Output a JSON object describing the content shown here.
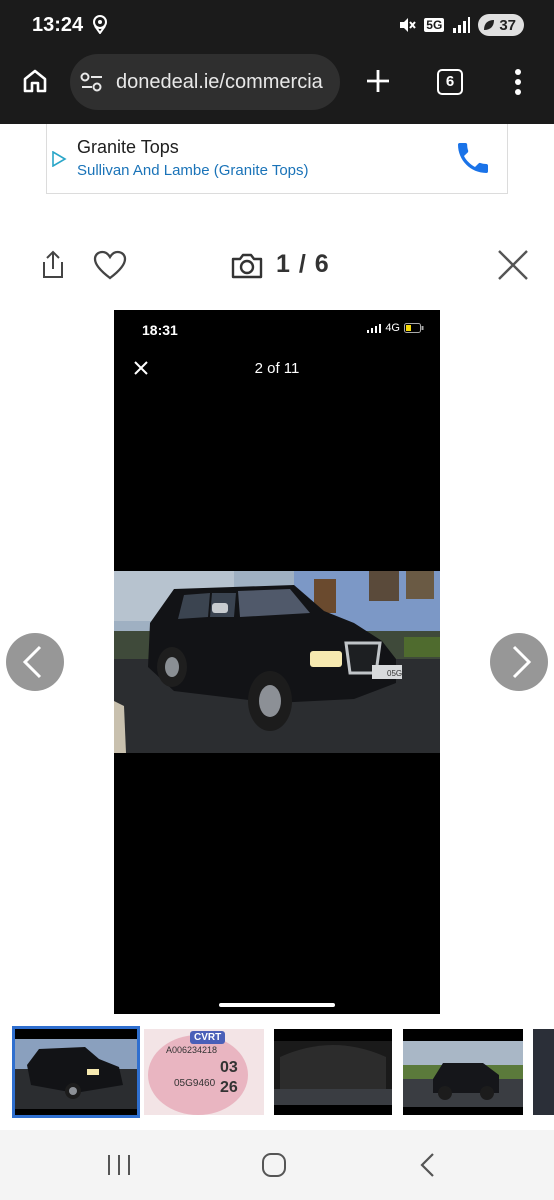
{
  "status_bar": {
    "time": "13:24",
    "network": "5G",
    "battery": "37"
  },
  "browser": {
    "url": "donedeal.ie/commercia",
    "tab_count": "6"
  },
  "ad": {
    "title": "Granite Tops",
    "subtitle": "Sullivan And Lambe (Granite Tops)"
  },
  "viewer": {
    "counter": "1 / 6"
  },
  "photo": {
    "phone_time": "18:31",
    "phone_network": "4G",
    "position": "2 of 11",
    "plate": "05G"
  },
  "thumbnails": {
    "cvrt_label": "CVRT",
    "cvrt_number": "A006234218",
    "cvrt_plate": "05G9460",
    "cvrt_month": "03",
    "cvrt_year": "26"
  },
  "colors": {
    "accent_blue": "#1a73b8",
    "phone_blue": "#1a73e8",
    "chrome_dark": "#1b1b1b"
  }
}
